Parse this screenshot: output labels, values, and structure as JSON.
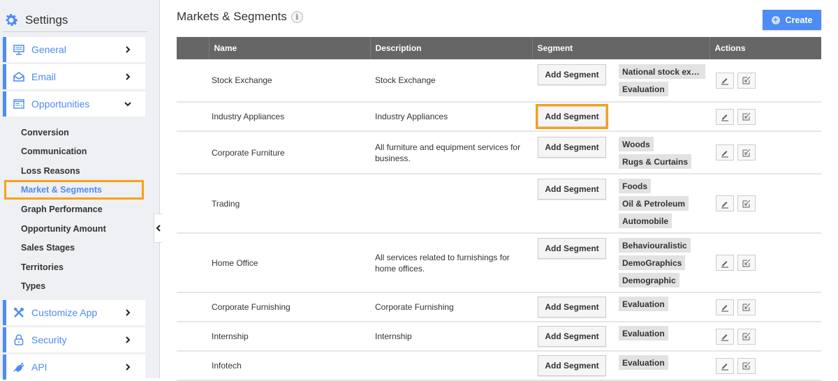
{
  "sidebar": {
    "title": "Settings",
    "nav": [
      {
        "label": "General",
        "icon": "monitor-icon",
        "state": "collapsed"
      },
      {
        "label": "Email",
        "icon": "envelope-icon",
        "state": "collapsed"
      },
      {
        "label": "Opportunities",
        "icon": "window-icon",
        "state": "expanded"
      }
    ],
    "sub_items": [
      {
        "label": "Conversion"
      },
      {
        "label": "Communication"
      },
      {
        "label": "Loss Reasons"
      },
      {
        "label": "Market & Segments",
        "active": true
      },
      {
        "label": "Graph Performance"
      },
      {
        "label": "Opportunity Amount"
      },
      {
        "label": "Sales Stages"
      },
      {
        "label": "Territories"
      },
      {
        "label": "Types"
      }
    ],
    "nav_bottom": [
      {
        "label": "Customize App",
        "icon": "tools-icon"
      },
      {
        "label": "Security",
        "icon": "lock-icon"
      },
      {
        "label": "API",
        "icon": "plug-icon"
      }
    ]
  },
  "main": {
    "title": "Markets & Segments",
    "info_icon": "i",
    "create_label": "Create",
    "columns": [
      "",
      "Name",
      "Description",
      "Segment",
      "",
      "Actions"
    ],
    "add_segment_label": "Add Segment",
    "rows": [
      {
        "name": "Stock Exchange",
        "description": "Stock Exchange",
        "segments": [
          "National stock exchange",
          "Evaluation"
        ]
      },
      {
        "name": "Industry Appliances",
        "description": "Industry Appliances",
        "segments": [],
        "highlighted": true
      },
      {
        "name": "Corporate Furniture",
        "description": "All furniture and equipment services for business.",
        "segments": [
          "Woods",
          "Rugs & Curtains"
        ]
      },
      {
        "name": "Trading",
        "description": "",
        "segments": [
          "Foods",
          "Oil & Petroleum",
          "Automobile"
        ]
      },
      {
        "name": "Home Office",
        "description": "All services related to furnishings for home offices.",
        "segments": [
          "Behaviouralistic",
          "DemoGraphics",
          "Demographic"
        ]
      },
      {
        "name": "Corporate Furnishing",
        "description": "Corporate Furnishing",
        "segments": [
          "Evaluation"
        ]
      },
      {
        "name": "Internship",
        "description": "Internship",
        "segments": [
          "Evaluation"
        ]
      },
      {
        "name": "Infotech",
        "description": "",
        "segments": [
          "Evaluation"
        ]
      }
    ]
  },
  "colors": {
    "accent": "#4d8bf5",
    "highlight": "#f7a11a",
    "header_bg": "#666666"
  }
}
